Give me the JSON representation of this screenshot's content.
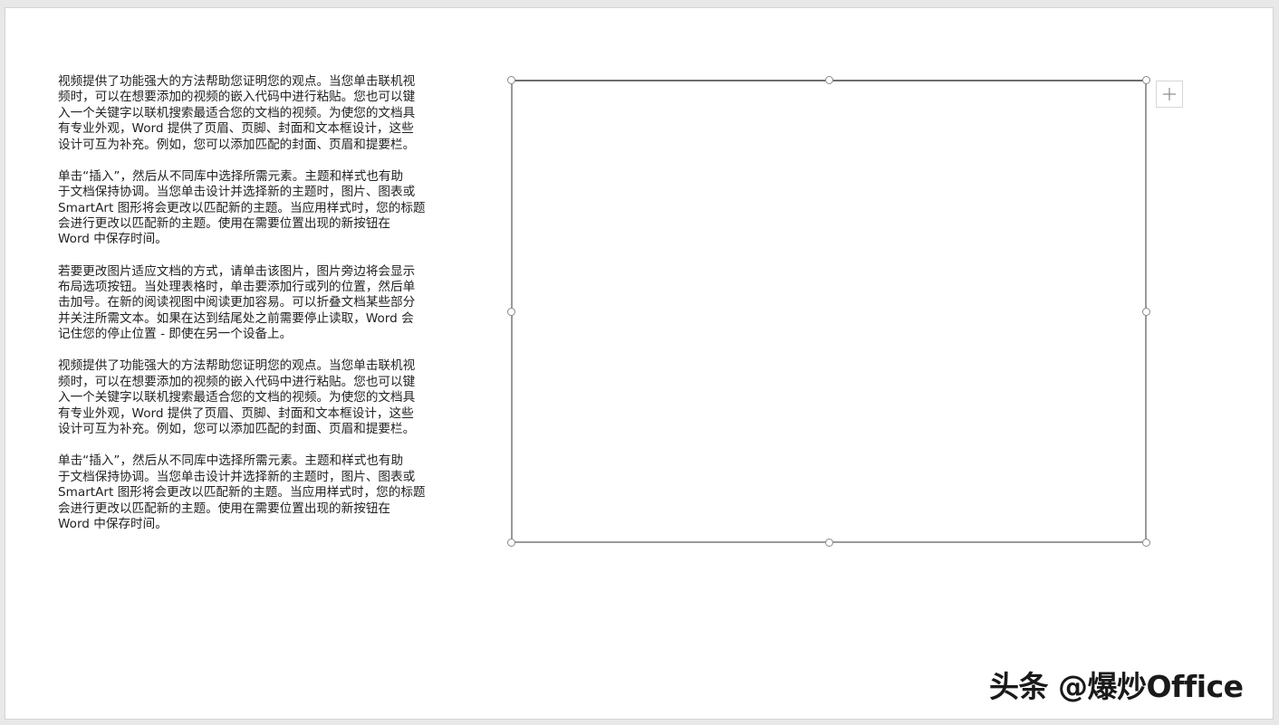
{
  "document": {
    "paragraphs": [
      "视频提供了功能强大的方法帮助您证明您的观点。当您单击联机视\n频时，可以在想要添加的视频的嵌入代码中进行粘贴。您也可以键\n入一个关键字以联机搜索最适合您的文档的视频。为使您的文档具\n有专业外观，Word 提供了页眉、页脚、封面和文本框设计，这些\n设计可互为补充。例如，您可以添加匹配的封面、页眉和提要栏。",
      "单击“插入”，然后从不同库中选择所需元素。主题和样式也有助\n于文档保持协调。当您单击设计并选择新的主题时，图片、图表或\nSmartArt 图形将会更改以匹配新的主题。当应用样式时，您的标题\n会进行更改以匹配新的主题。使用在需要位置出现的新按钮在\nWord 中保存时间。",
      "若要更改图片适应文档的方式，请单击该图片，图片旁边将会显示\n布局选项按钮。当处理表格时，单击要添加行或列的位置，然后单\n击加号。在新的阅读视图中阅读更加容易。可以折叠文档某些部分\n并关注所需文本。如果在达到结尾处之前需要停止读取，Word 会\n记住您的停止位置 - 即使在另一个设备上。",
      "视频提供了功能强大的方法帮助您证明您的观点。当您单击联机视\n频时，可以在想要添加的视频的嵌入代码中进行粘贴。您也可以键\n入一个关键字以联机搜索最适合您的文档的视频。为使您的文档具\n有专业外观，Word 提供了页眉、页脚、封面和文本框设计，这些\n设计可互为补充。例如，您可以添加匹配的封面、页眉和提要栏。",
      "单击“插入”，然后从不同库中选择所需元素。主题和样式也有助\n于文档保持协调。当您单击设计并选择新的主题时，图片、图表或\nSmartArt 图形将会更改以匹配新的主题。当应用样式时，您的标题\n会进行更改以匹配新的主题。使用在需要位置出现的新按钮在\nWord 中保存时间。"
    ]
  },
  "shape": {
    "layout_options_icon": "plus-icon",
    "border_color": "#9a9a9a",
    "handle_color": "#8a8a8a"
  },
  "watermark": {
    "text": "头条 @爆炒Office"
  }
}
